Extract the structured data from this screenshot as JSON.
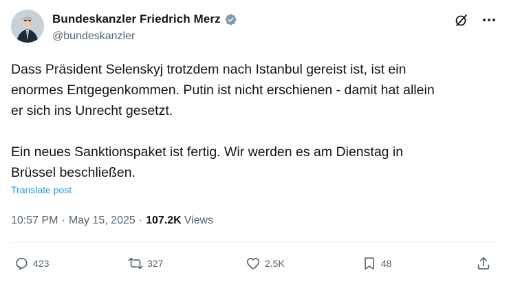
{
  "author": {
    "display_name": "Bundeskanzler Friedrich Merz",
    "handle": "@bundeskanzler",
    "verified_color": "#829aab"
  },
  "post": {
    "text": "Dass Präsident Selenskyj trotzdem nach Istanbul gereist ist, ist ein\nenormes Entgegenkommen. Putin ist nicht erschienen - damit hat allein\ner sich ins Unrecht gesetzt.\n\nEin neues Sanktionspaket ist fertig. Wir werden es am Dienstag in\nBrüssel beschließen.",
    "translate_label": "Translate post"
  },
  "meta": {
    "time": "10:57 PM",
    "separator": "·",
    "date": "May 15, 2025",
    "separator2": "·",
    "views_count": "107.2K",
    "views_label": "Views"
  },
  "actions": {
    "replies": "423",
    "reposts": "327",
    "likes": "2.5K",
    "bookmarks": "48"
  },
  "colors": {
    "text": "#0f1419",
    "secondary": "#536471",
    "link": "#1d9bf0"
  }
}
